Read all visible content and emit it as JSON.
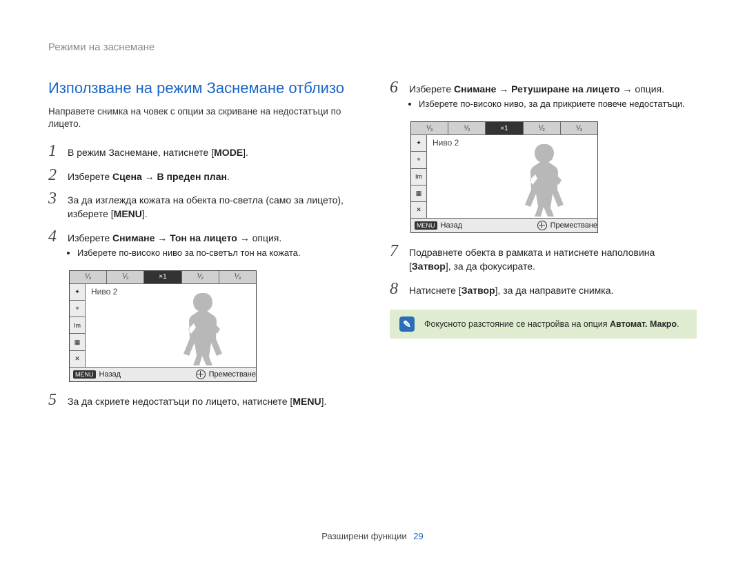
{
  "breadcrumb": "Режими на заснемане",
  "title": "Използване на режим Заснемане отблизо",
  "intro": "Направете снимка на човек с опции за скриване на недостатъци по лицето.",
  "steps": {
    "s1": {
      "num": "1",
      "pre": "В режим Заснемане, натиснете [",
      "btn": "MODE",
      "post": "]."
    },
    "s2": {
      "num": "2",
      "pre": "Изберете ",
      "bold": "Сцена → В преден план",
      "post": "."
    },
    "s3": {
      "num": "3",
      "a": "За да изглежда кожата на обекта по-светла (само за лицето), изберете [",
      "btn": "MENU",
      "b": "]."
    },
    "s4": {
      "num": "4",
      "pre": "Изберете ",
      "bold": "Снимане → Тон на лицето",
      "post": " → опция.",
      "bullet": "Изберете по-високо ниво за по-светъл тон на кожата."
    },
    "s5": {
      "num": "5",
      "a": "За да скриете недостатъци по лицето, натиснете [",
      "btn": "MENU",
      "b": "]."
    },
    "s6": {
      "num": "6",
      "pre": "Изберете ",
      "bold": "Снимане → Ретуширане на лицето",
      "post": " → опция.",
      "bullet": "Изберете по-високо ниво, за да прикриете повече недостатъци."
    },
    "s7": {
      "num": "7",
      "a": "Подравнете обекта в рамката и натиснете наполовина [",
      "btn": "Затвор",
      "b": "], за да фокусирате."
    },
    "s8": {
      "num": "8",
      "a": "Натиснете [",
      "btn": "Затвор",
      "b": "], за да направите снимка."
    }
  },
  "lcd": {
    "level": "Ниво 2",
    "top_cells": [
      "⅟₃",
      "⅟₂",
      "×1",
      "⅟₂",
      "⅟₃"
    ],
    "left_icons": [
      "✦",
      "⌖",
      "Im",
      "▦",
      "✕"
    ],
    "menu_chip": "MENU",
    "back_label": "Назад",
    "move_label": "Преместване"
  },
  "note": {
    "pre": "Фокусното разстояние се настройва на опция ",
    "bold": "Автомат. Макро",
    "post": "."
  },
  "footer": {
    "section": "Разширени функции",
    "page": "29"
  }
}
